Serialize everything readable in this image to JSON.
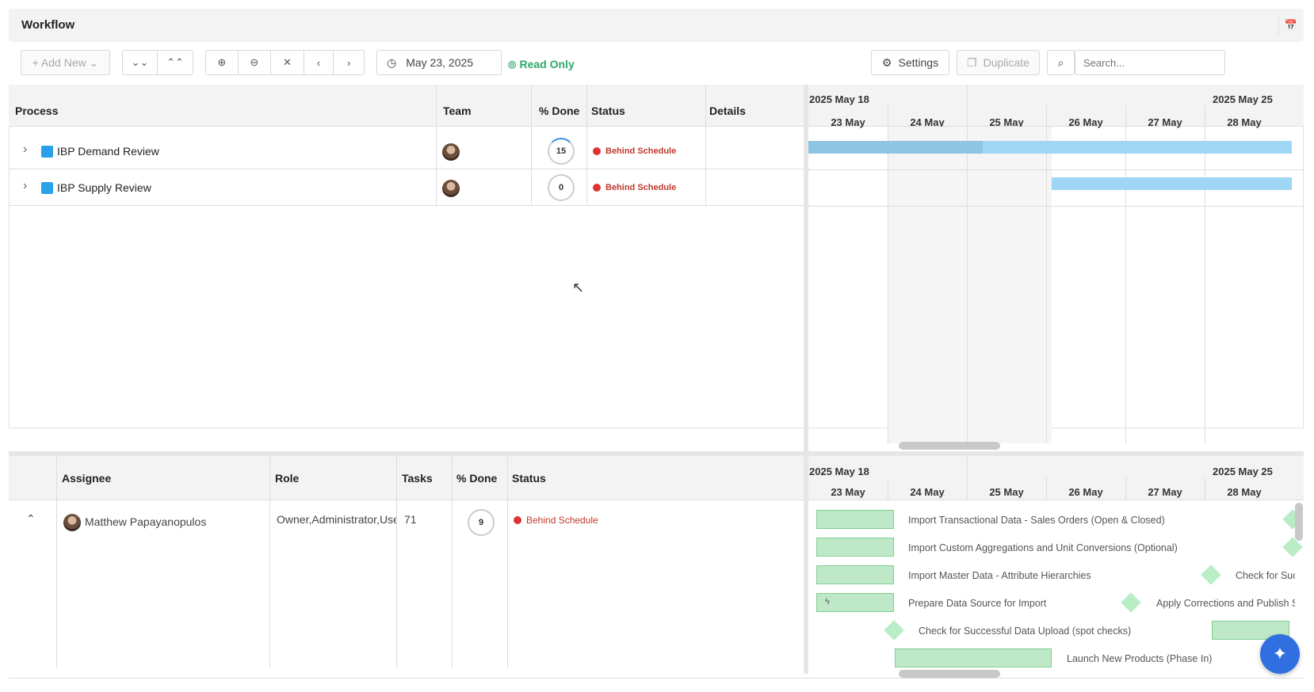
{
  "title": "Workflow",
  "toolbar": {
    "add_new": "+ Add New",
    "date": "May 23, 2025",
    "read_only": "Read Only",
    "settings": "Settings",
    "duplicate": "Duplicate",
    "search_placeholder": "Search..."
  },
  "process_table": {
    "headers": {
      "process": "Process",
      "team": "Team",
      "done": "% Done",
      "status": "Status",
      "details": "Details"
    },
    "rows": [
      {
        "name": "IBP Demand Review",
        "done": "15",
        "status": "Behind Schedule"
      },
      {
        "name": "IBP Supply Review",
        "done": "0",
        "status": "Behind Schedule"
      }
    ]
  },
  "gantt": {
    "week1": "2025 May 18",
    "week2": "2025 May 25",
    "days": [
      "23 May",
      "24 May",
      "25 May",
      "26 May",
      "27 May",
      "28 May"
    ]
  },
  "assignee_table": {
    "headers": {
      "assignee": "Assignee",
      "role": "Role",
      "tasks": "Tasks",
      "done": "% Done",
      "status": "Status"
    },
    "row": {
      "name": "Matthew Papayanopulos",
      "role": "Owner,Administrator,User",
      "tasks": "71",
      "done": "9",
      "status": "Behind Schedule"
    }
  },
  "tasks": [
    "Import Transactional Data - Sales Orders (Open & Closed)",
    "Import Custom Aggregations and Unit Conversions (Optional)",
    "Import Master Data - Attribute Hierarchies",
    "Check for Successful Data Upload",
    "Prepare Data Source for Import",
    "Apply Corrections and Publish Sales",
    "Check for Successful Data Upload (spot checks)",
    "Launch New Products (Phase In)"
  ]
}
